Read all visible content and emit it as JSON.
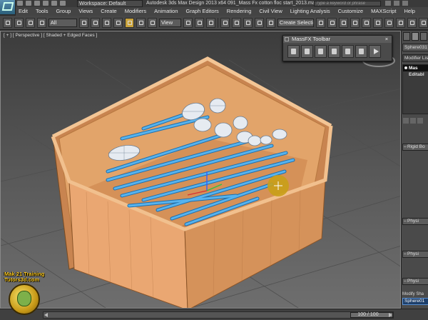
{
  "titlebar": {
    "workspace": "Workspace: Default",
    "title": "Autodesk 3ds Max Design 2013 x64      091_Mass Fx cotton floc start_2013.max",
    "search_placeholder": "Type a keyword or phrase"
  },
  "menu": [
    "Edit",
    "Tools",
    "Group",
    "Views",
    "Create",
    "Modifiers",
    "Animation",
    "Graph Editors",
    "Rendering",
    "Civil View",
    "Lighting Analysis",
    "Customize",
    "MAXScript",
    "Help"
  ],
  "toolbar": {
    "selection_filter": "All",
    "reference_coord": "View",
    "named_selection": "Create Selection Se"
  },
  "viewport": {
    "label_parts": [
      "[ + ]",
      "[ Perspective ]",
      "[ Shaded + Edged Faces ]"
    ]
  },
  "massfx": {
    "title": "MassFX Toolbar"
  },
  "command_panel": {
    "object_name": "Sphere031",
    "modifier_list": "Modifier List",
    "stack": [
      "Mas",
      "Editabl"
    ],
    "rollouts": [
      "Rigid Bo",
      "Physi",
      "Physi",
      "Physi"
    ],
    "modify_shape_label": "Modify Sha",
    "modify_shape_value": "Sphere01"
  },
  "time_slider": {
    "frame_text": "100 / 100"
  },
  "watermark": {
    "line1": "Mak 21 Training",
    "line2": "Tutors3d.com"
  },
  "colors": {
    "box": "#e8a870",
    "swab_stick": "#3a9ad8",
    "swab_head": "#dfe6ee",
    "gizmo": "#c9a018"
  }
}
